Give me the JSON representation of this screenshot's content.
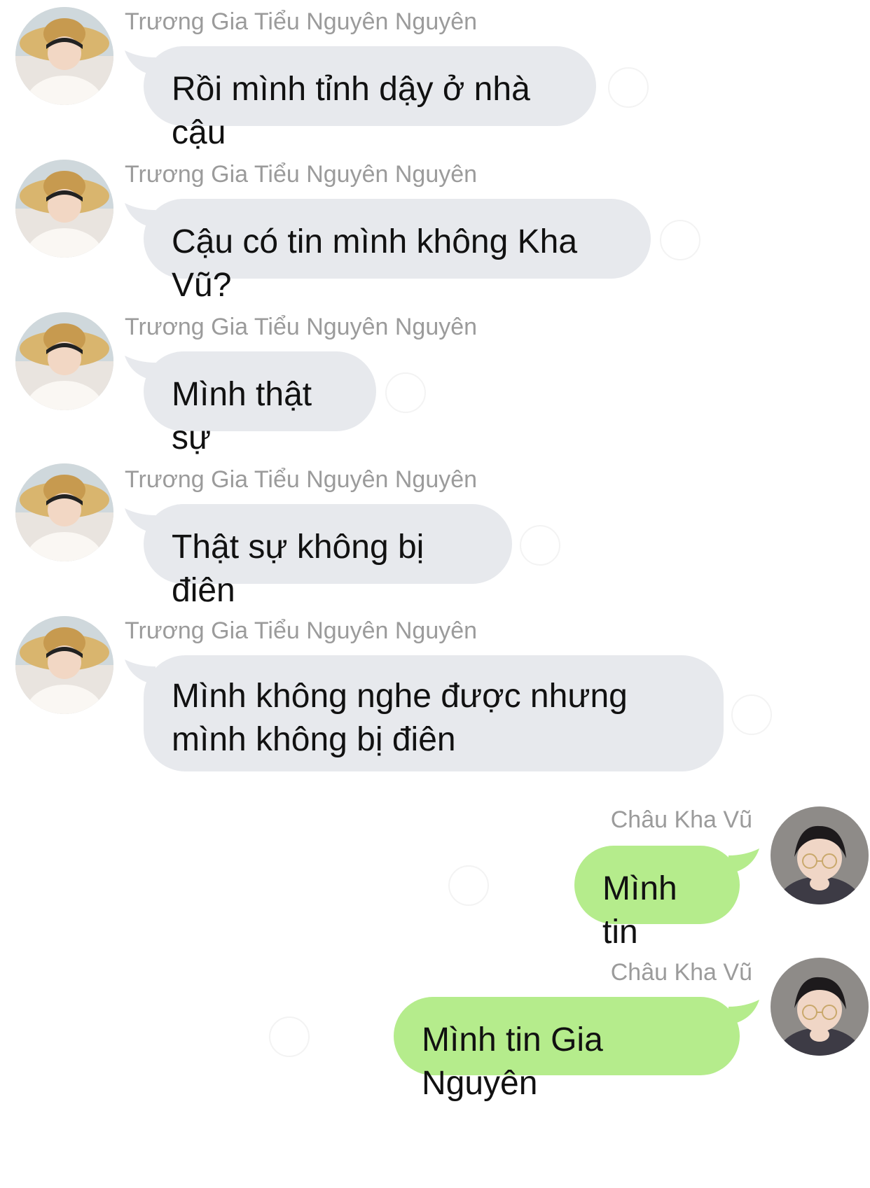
{
  "colors": {
    "incoming_bubble": "#e7e9ed",
    "outgoing_bubble": "#b5ec8c",
    "sender_name": "#9b9b9b",
    "text": "#111111",
    "background": "#ffffff"
  },
  "messages": [
    {
      "sender": "Trương Gia Tiểu Nguyên Nguyên",
      "text": "Rồi mình tỉnh dậy ở nhà cậu",
      "direction": "incoming",
      "avatar_icon": "user-avatar-straw-hat"
    },
    {
      "sender": "Trương Gia Tiểu Nguyên Nguyên",
      "text": "Cậu có tin mình không Kha Vũ?",
      "direction": "incoming",
      "avatar_icon": "user-avatar-straw-hat"
    },
    {
      "sender": "Trương Gia Tiểu Nguyên Nguyên",
      "text": "Mình thật sự",
      "direction": "incoming",
      "avatar_icon": "user-avatar-straw-hat"
    },
    {
      "sender": "Trương Gia Tiểu Nguyên Nguyên",
      "text": "Thật sự không bị điên",
      "direction": "incoming",
      "avatar_icon": "user-avatar-straw-hat"
    },
    {
      "sender": "Trương Gia Tiểu Nguyên Nguyên",
      "text": "Mình không nghe được nhưng mình không bị điên",
      "direction": "incoming",
      "avatar_icon": "user-avatar-straw-hat"
    },
    {
      "sender": "Châu Kha Vũ",
      "text": "Mình tin",
      "direction": "outgoing",
      "avatar_icon": "user-avatar-glasses"
    },
    {
      "sender": "Châu Kha Vũ",
      "text": "Mình tin Gia Nguyên",
      "direction": "outgoing",
      "avatar_icon": "user-avatar-glasses"
    }
  ]
}
